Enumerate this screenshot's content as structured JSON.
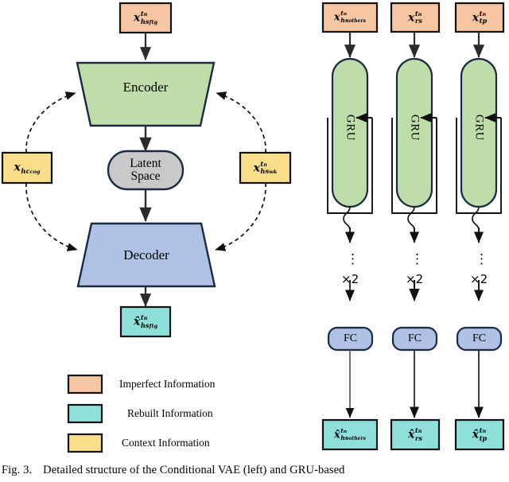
{
  "figure": {
    "caption_label": "Fig. 3.",
    "caption_text": "Detailed structure of the Conditional VAE (left) and GRU-based"
  },
  "colors": {
    "imperfect": "#F6C6A2",
    "rebuilt": "#8FE0DA",
    "context": "#FBDE8A",
    "encoder_green": "#BFDDA8",
    "decoder_blue": "#AFC2E5",
    "latent_gray": "#C9C9C9",
    "fc_blue": "#AFC2E5",
    "outline": "#1B2A44"
  },
  "left_panel": {
    "title": "Conditional VAE",
    "input_box": {
      "base": "x",
      "sup": "t",
      "sup_sub": "n",
      "sub": "hs",
      "sub_sub": "ftg"
    },
    "encoder": {
      "label": "Encoder"
    },
    "latent": {
      "line1": "Latent",
      "line2": "Space"
    },
    "decoder": {
      "label": "Decoder"
    },
    "output_box": {
      "base": "x̂",
      "sup": "t",
      "sup_sub": "n",
      "sub": "hs",
      "sub_sub": "ftg"
    },
    "context_left": {
      "base": "x",
      "sup": "",
      "sup_sub": "",
      "sub": "hc",
      "sub_sub": "cog"
    },
    "context_right": {
      "base": "x",
      "sup": "t",
      "sup_sub": "n",
      "sub": "hs",
      "sub_sub": "wk"
    }
  },
  "right_panel": {
    "title": "GRU-based",
    "columns": [
      {
        "input": {
          "base": "x",
          "sup": "t",
          "sup_sub": "n",
          "sub": "hs",
          "sub_sub": "others"
        },
        "gru_label": "GRU",
        "repeat": "×2",
        "fc_label": "FC",
        "output": {
          "base": "x̂",
          "sup": "t",
          "sup_sub": "n",
          "sub": "hs",
          "sub_sub": "others"
        }
      },
      {
        "input": {
          "base": "x",
          "sup": "t",
          "sup_sub": "n",
          "sub": "rs",
          "sub_sub": ""
        },
        "gru_label": "GRU",
        "repeat": "×2",
        "fc_label": "FC",
        "output": {
          "base": "x̂",
          "sup": "t",
          "sup_sub": "n",
          "sub": "rs",
          "sub_sub": ""
        }
      },
      {
        "input": {
          "base": "x",
          "sup": "t",
          "sup_sub": "n",
          "sub": "tp",
          "sub_sub": ""
        },
        "gru_label": "GRU",
        "repeat": "×2",
        "fc_label": "FC",
        "output": {
          "base": "x̂",
          "sup": "t",
          "sup_sub": "n",
          "sub": "tp",
          "sub_sub": ""
        }
      }
    ],
    "dots_glyph": "⋮"
  },
  "legend": {
    "items": [
      {
        "swatch": "#F6C6A2",
        "label": "Imperfect Information"
      },
      {
        "swatch": "#8FE0DA",
        "label": "Rebuilt Information"
      },
      {
        "swatch": "#FBDE8A",
        "label": "Context Information"
      }
    ]
  }
}
